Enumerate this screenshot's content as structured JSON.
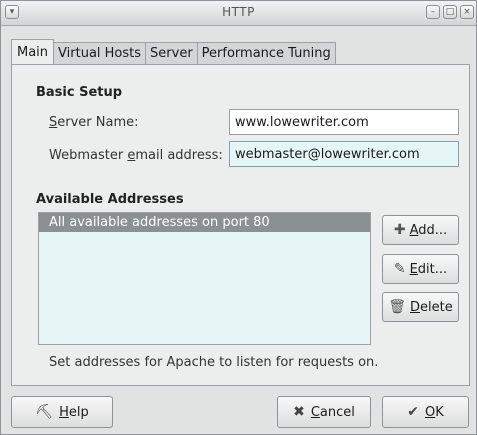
{
  "window": {
    "title": "HTTP",
    "menu_icon": "chevron-down-icon",
    "min_icon": "minimize-icon",
    "max_icon": "maximize-icon",
    "close_icon": "close-icon"
  },
  "tabs": [
    {
      "label": "Main",
      "active": true
    },
    {
      "label": "Virtual Hosts",
      "active": false
    },
    {
      "label": "Server",
      "active": false
    },
    {
      "label": "Performance Tuning",
      "active": false
    }
  ],
  "basic_setup": {
    "title": "Basic Setup",
    "server_name_label_mn": "S",
    "server_name_label_rest": "erver Name:",
    "server_name_value": "www.lowewriter.com",
    "webmaster_label_pre": "Webmaster ",
    "webmaster_label_mn": "e",
    "webmaster_label_rest": "mail address:",
    "webmaster_value": "webmaster@lowewriter.com"
  },
  "addresses": {
    "title": "Available Addresses",
    "items": [
      "All available addresses on port 80"
    ],
    "hint": "Set addresses for Apache to listen for requests on."
  },
  "side_buttons": {
    "add": {
      "mn": "A",
      "rest": "dd...",
      "icon": "add-icon"
    },
    "edit": {
      "mn": "E",
      "rest": "dit...",
      "icon": "edit-icon"
    },
    "delete": {
      "mn": "D",
      "rest": "elete",
      "icon": "delete-icon"
    }
  },
  "bottom_buttons": {
    "help": {
      "mn": "H",
      "rest": "elp",
      "icon": "help-icon"
    },
    "cancel": {
      "mn": "C",
      "rest": "ancel",
      "icon": "cancel-icon"
    },
    "ok": {
      "mn": "O",
      "rest": "K",
      "icon": "ok-icon"
    }
  },
  "colors": {
    "list_bg": "#e6f6f6",
    "selected_row": "#8b9193"
  }
}
